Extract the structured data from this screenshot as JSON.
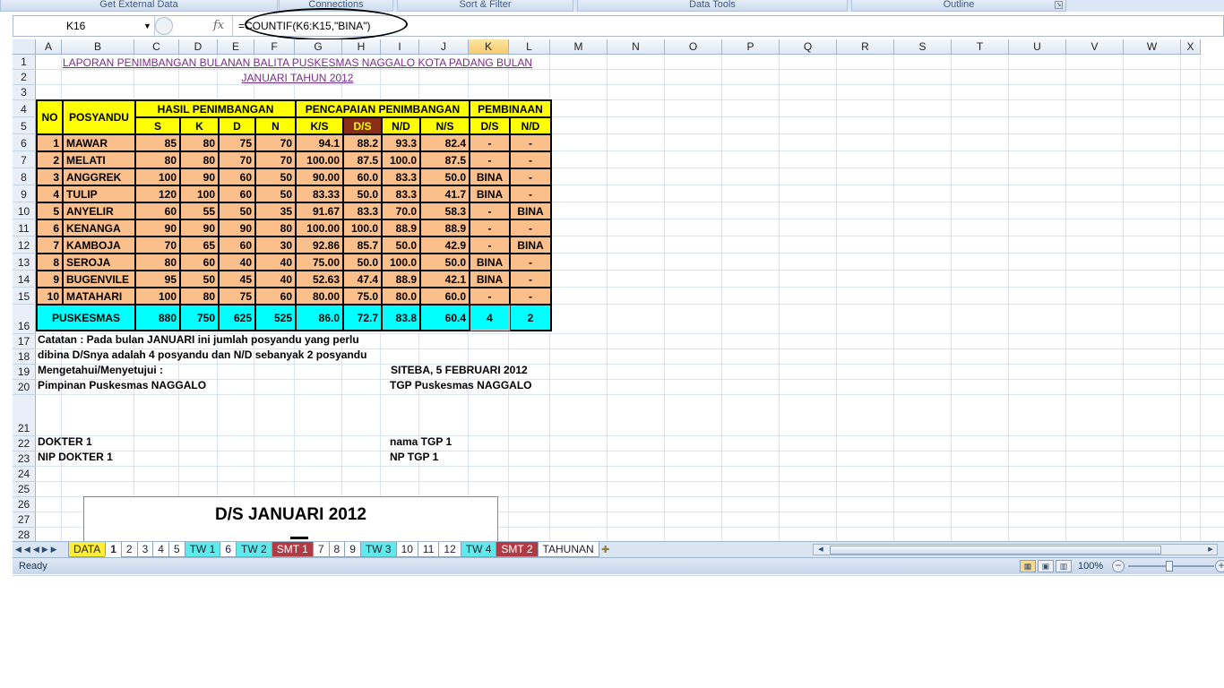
{
  "ribbon": {
    "groups": [
      {
        "label": "Get External Data"
      },
      {
        "label": "Connections"
      },
      {
        "label": "Sort & Filter"
      },
      {
        "label": "Data Tools"
      },
      {
        "label": "Outline"
      }
    ]
  },
  "formula_bar": {
    "name_box": "K16",
    "fx_label": "fx",
    "formula": "=COUNTIF(K6:K15,\"BINA\")"
  },
  "columns": [
    "A",
    "B",
    "C",
    "D",
    "E",
    "F",
    "G",
    "H",
    "I",
    "J",
    "K",
    "L",
    "M",
    "N",
    "O",
    "P",
    "Q",
    "R",
    "S",
    "T",
    "U",
    "V",
    "W",
    "X"
  ],
  "selected_column": "K",
  "rows": [
    "1",
    "2",
    "3",
    "4",
    "5",
    "6",
    "7",
    "8",
    "9",
    "10",
    "11",
    "12",
    "13",
    "14",
    "15",
    "16",
    "17",
    "18",
    "19",
    "20",
    "21",
    "22",
    "23",
    "24",
    "25",
    "26",
    "27",
    "28"
  ],
  "sheet": {
    "title_line1": "LAPORAN PENIMBANGAN BULANAN BALITA PUSKESMAS NAGGALO KOTA PADANG BULAN",
    "title_line2": "JANUARI TAHUN 2012",
    "header": {
      "no": "NO",
      "posyandu": "POSYANDU",
      "hasil": "HASIL PENIMBANGAN",
      "pencapaian": "PENCAPAIAN PENIMBANGAN",
      "pembinaan": "PEMBINAAN",
      "sub": [
        "S",
        "K",
        "D",
        "N",
        "K/S",
        "D/S",
        "N/D",
        "N/S",
        "D/S",
        "N/D"
      ]
    },
    "data_rows": [
      [
        "1",
        "MAWAR",
        "85",
        "80",
        "75",
        "70",
        "94.1",
        "88.2",
        "93.3",
        "82.4",
        "-",
        "-"
      ],
      [
        "2",
        "MELATI",
        "80",
        "80",
        "70",
        "70",
        "100.00",
        "87.5",
        "100.0",
        "87.5",
        "-",
        "-"
      ],
      [
        "3",
        "ANGGREK",
        "100",
        "90",
        "60",
        "50",
        "90.00",
        "60.0",
        "83.3",
        "50.0",
        "BINA",
        "-"
      ],
      [
        "4",
        "TULIP",
        "120",
        "100",
        "60",
        "50",
        "83.33",
        "50.0",
        "83.3",
        "41.7",
        "BINA",
        "-"
      ],
      [
        "5",
        "ANYELIR",
        "60",
        "55",
        "50",
        "35",
        "91.67",
        "83.3",
        "70.0",
        "58.3",
        "-",
        "BINA"
      ],
      [
        "6",
        "KENANGA",
        "90",
        "90",
        "90",
        "80",
        "100.00",
        "100.0",
        "88.9",
        "88.9",
        "-",
        "-"
      ],
      [
        "7",
        "KAMBOJA",
        "70",
        "65",
        "60",
        "30",
        "92.86",
        "85.7",
        "50.0",
        "42.9",
        "-",
        "BINA"
      ],
      [
        "8",
        "SEROJA",
        "80",
        "60",
        "40",
        "40",
        "75.00",
        "50.0",
        "100.0",
        "50.0",
        "BINA",
        "-"
      ],
      [
        "9",
        "BUGENVILE",
        "95",
        "50",
        "45",
        "40",
        "52.63",
        "47.4",
        "88.9",
        "42.1",
        "BINA",
        "-"
      ],
      [
        "10",
        "MATAHARI",
        "100",
        "80",
        "75",
        "60",
        "80.00",
        "75.0",
        "80.0",
        "60.0",
        "-",
        "-"
      ]
    ],
    "total": {
      "label": "PUSKESMAS",
      "values": [
        "880",
        "750",
        "625",
        "525",
        "86.0",
        "72.7",
        "83.8",
        "60.4",
        "4",
        "2"
      ]
    },
    "notes": {
      "catatan1": "Catatan : Pada bulan JANUARI ini jumlah posyandu yang perlu",
      "catatan2": "dibina D/Snya adalah 4 posyandu dan N/D sebanyak 2 posyandu",
      "mengetahui": "Mengetahui/Menyetujui :",
      "tanggal": "SITEBA, 5 FEBRUARI 2012",
      "pimpinan": "Pimpinan Puskesmas NAGGALO",
      "tgp": "TGP Puskesmas NAGGALO",
      "dokter": "DOKTER 1",
      "nama_tgp": "nama TGP 1",
      "nip_dokter": "NIP DOKTER 1",
      "np_tgp": "NP TGP 1"
    },
    "chart_title": "D/S  JANUARI 2012"
  },
  "sheet_tabs": [
    {
      "label": "DATA",
      "style": "y"
    },
    {
      "label": "1",
      "style": "act"
    },
    {
      "label": "2",
      "style": ""
    },
    {
      "label": "3",
      "style": ""
    },
    {
      "label": "4",
      "style": ""
    },
    {
      "label": "5",
      "style": ""
    },
    {
      "label": "TW 1",
      "style": "c"
    },
    {
      "label": "6",
      "style": ""
    },
    {
      "label": "TW 2",
      "style": "c"
    },
    {
      "label": "SMT 1",
      "style": "r"
    },
    {
      "label": "7",
      "style": ""
    },
    {
      "label": "8",
      "style": ""
    },
    {
      "label": "9",
      "style": ""
    },
    {
      "label": "TW 3",
      "style": "c"
    },
    {
      "label": "10",
      "style": ""
    },
    {
      "label": "11",
      "style": ""
    },
    {
      "label": "12",
      "style": ""
    },
    {
      "label": "TW 4",
      "style": "c"
    },
    {
      "label": "SMT 2",
      "style": "r"
    },
    {
      "label": "TAHUNAN",
      "style": ""
    }
  ],
  "status": {
    "ready": "Ready",
    "zoom": "100%"
  },
  "colors": {
    "header_yellow": "#ffff00",
    "body_orange": "#fbbf8b",
    "total_cyan": "#00ffff",
    "ds_header": "#8b2e18"
  }
}
